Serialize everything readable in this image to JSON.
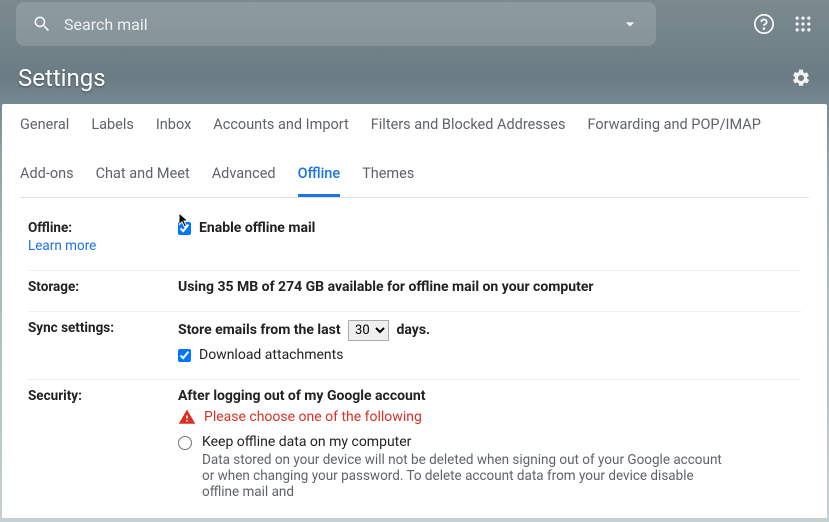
{
  "search": {
    "placeholder": "Search mail"
  },
  "title": "Settings",
  "tabs": [
    "General",
    "Labels",
    "Inbox",
    "Accounts and Import",
    "Filters and Blocked Addresses",
    "Forwarding and POP/IMAP",
    "Add-ons",
    "Chat and Meet",
    "Advanced",
    "Offline",
    "Themes"
  ],
  "activeTab": "Offline",
  "offline": {
    "label": "Offline:",
    "learn": "Learn more",
    "enable": "Enable offline mail"
  },
  "storage": {
    "label": "Storage:",
    "text": "Using 35 MB of 274 GB available for offline mail on your computer"
  },
  "sync": {
    "label": "Sync settings:",
    "prefix": "Store emails from the last",
    "value": "30",
    "suffix": "days.",
    "download": "Download attachments"
  },
  "security": {
    "label": "Security:",
    "header": "After logging out of my Google account",
    "warn": "Please choose one of the following",
    "opt1": "Keep offline data on my computer",
    "opt1desc": "Data stored on your device will not be deleted when signing out of your Google account or when changing your password. To delete account data from your device disable offline mail and"
  }
}
